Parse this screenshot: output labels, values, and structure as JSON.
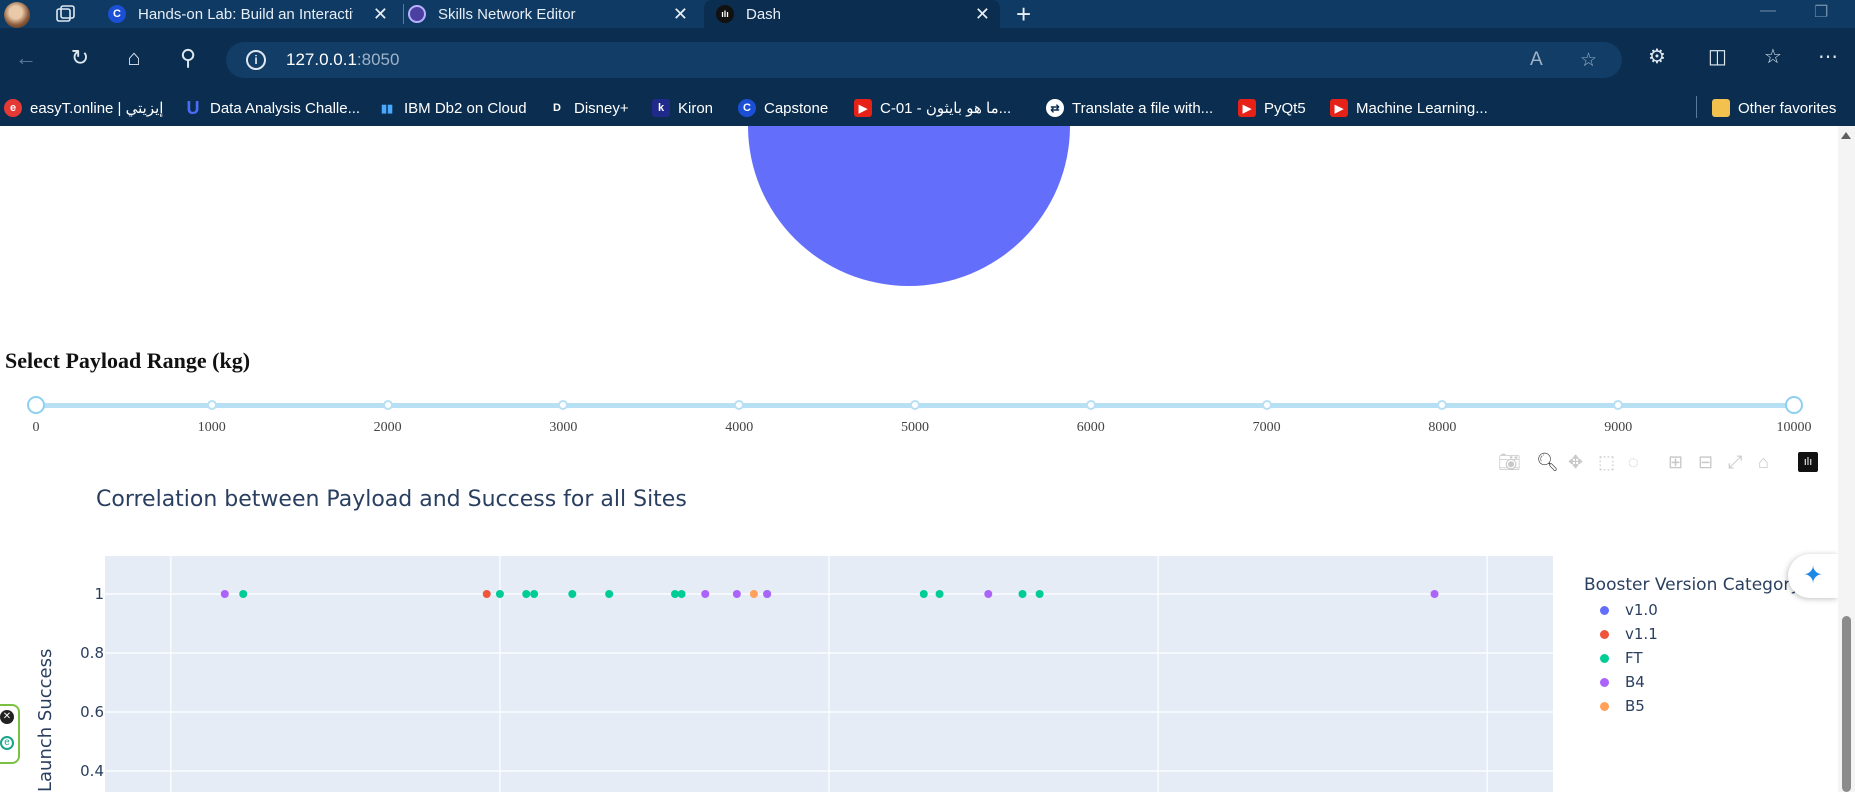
{
  "browser": {
    "tabs": [
      {
        "title": "Hands-on Lab: Build an Interactive Dashboard with Plotly Dash",
        "favicon": "C",
        "favicon_color": "#1b4fd6"
      },
      {
        "title": "Skills Network Editor",
        "favicon": "",
        "favicon_color": "#4b3fa0"
      },
      {
        "title": "Dash",
        "favicon": "",
        "favicon_color": "#111111",
        "active": true
      }
    ],
    "url_host": "127.0.0.1",
    "url_port": ":8050",
    "bookmarks": [
      {
        "label": "easyT.online | إيزيتي",
        "icon_color": "#e53935"
      },
      {
        "label": "Data Analysis Challe...",
        "icon_color": "#4a6cf7"
      },
      {
        "label": "IBM Db2 on Cloud",
        "icon_color": "#1a73e8"
      },
      {
        "label": "Disney+",
        "icon_color": "#0b2e50"
      },
      {
        "label": "Kiron",
        "icon_color": "#1f2a8a"
      },
      {
        "label": "Capstone",
        "icon_color": "#1b4fd6"
      },
      {
        "label": "C-01 - ما هو بايثون...",
        "icon_color": "#e62117"
      },
      {
        "label": "Translate a file with...",
        "icon_color": "#ffffff"
      },
      {
        "label": "PyQt5",
        "icon_color": "#e62117"
      },
      {
        "label": "Machine Learning...",
        "icon_color": "#e62117"
      },
      {
        "label": "Other favorites",
        "icon_color": "#f2c14e"
      }
    ]
  },
  "dashboard": {
    "payload_title": "Select Payload Range (kg)",
    "slider": {
      "min": 0,
      "max": 10000,
      "value": [
        0,
        10000
      ],
      "marks": [
        "0",
        "1000",
        "2000",
        "3000",
        "4000",
        "5000",
        "6000",
        "7000",
        "8000",
        "9000",
        "10000"
      ],
      "color": "#b7e0f5"
    },
    "pie_color": "#636efa"
  },
  "chart_data": {
    "type": "scatter",
    "title": "Correlation between Payload and Success for all Sites",
    "xlabel": "",
    "ylabel": "Launch Success",
    "xlim": [
      -500,
      10500
    ],
    "ylim_visible": [
      0.35,
      1.07
    ],
    "y_ticks": [
      "1",
      "0.8",
      "0.6",
      "0.4"
    ],
    "x_gridlines": [
      0,
      2500,
      5000,
      7500,
      10000
    ],
    "grid": true,
    "legend": {
      "title": "Booster Version Category",
      "placement": "right"
    },
    "series": [
      {
        "name": "v1.0",
        "color": "#636efa",
        "points": []
      },
      {
        "name": "v1.1",
        "color": "#ef553b",
        "points": [
          {
            "x": 2400,
            "y": 1
          }
        ]
      },
      {
        "name": "FT",
        "color": "#00cc96",
        "points": [
          {
            "x": 550,
            "y": 1
          },
          {
            "x": 2500,
            "y": 1
          },
          {
            "x": 2700,
            "y": 1
          },
          {
            "x": 2760,
            "y": 1
          },
          {
            "x": 3050,
            "y": 1
          },
          {
            "x": 3330,
            "y": 1
          },
          {
            "x": 3830,
            "y": 1
          },
          {
            "x": 3880,
            "y": 1
          },
          {
            "x": 4530,
            "y": 1
          },
          {
            "x": 5720,
            "y": 1
          },
          {
            "x": 5840,
            "y": 1
          },
          {
            "x": 6470,
            "y": 1
          },
          {
            "x": 6600,
            "y": 1
          }
        ]
      },
      {
        "name": "B4",
        "color": "#ab63fa",
        "points": [
          {
            "x": 410,
            "y": 1
          },
          {
            "x": 4060,
            "y": 1
          },
          {
            "x": 4300,
            "y": 1
          },
          {
            "x": 4530,
            "y": 1
          },
          {
            "x": 6210,
            "y": 1
          },
          {
            "x": 9600,
            "y": 1
          }
        ]
      },
      {
        "name": "B5",
        "color": "#ffa15a",
        "points": [
          {
            "x": 4430,
            "y": 1
          }
        ]
      }
    ]
  }
}
